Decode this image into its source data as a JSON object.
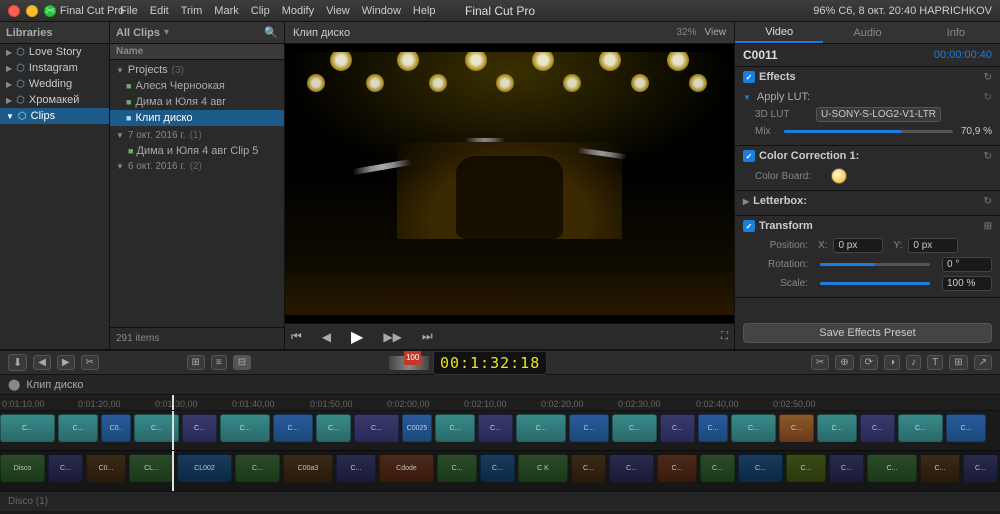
{
  "titlebar": {
    "title": "Final Cut Pro",
    "app": "Final Cut Pro",
    "menus": [
      "File",
      "Edit",
      "Trim",
      "Mark",
      "Clip",
      "Modify",
      "View",
      "Window",
      "Help"
    ],
    "right_info": "96%  С6, 8 окт.  20:40  HAPRICHKOV"
  },
  "libraries": {
    "header": "Libraries",
    "items": [
      {
        "label": "Love Story",
        "indent": 1
      },
      {
        "label": "Instagram",
        "indent": 1
      },
      {
        "label": "Wedding",
        "indent": 1
      },
      {
        "label": "Хромакей",
        "indent": 1
      },
      {
        "label": "Clips",
        "indent": 1,
        "active": true
      }
    ]
  },
  "browser": {
    "header": "All Clips",
    "count_label": "291 items",
    "col_header": "Name",
    "projects_label": "Projects",
    "projects_count": "3",
    "items": [
      {
        "label": "Алеся Черноокая"
      },
      {
        "label": "Дима и Юля 4 авг",
        "selected": true
      },
      {
        "label": "Клип диско"
      }
    ],
    "date_groups": [
      {
        "label": "7 окт. 2016 г.",
        "count": "1",
        "items": [
          "Дима и Юля 4 авг Clip 5"
        ]
      },
      {
        "label": "6 окт. 2016 г.",
        "count": "2",
        "items": []
      }
    ]
  },
  "preview": {
    "title": "Клип диско",
    "zoom": "32%",
    "view_label": "View",
    "timecode": "00:01:32:18",
    "fullscreen_btn": "⛶"
  },
  "inspector": {
    "tabs": [
      "Video",
      "Audio",
      "Info"
    ],
    "active_tab": "Video",
    "clip_name": "C0011",
    "clip_time": "00:00:00:40",
    "sections": {
      "effects": {
        "header": "Effects",
        "apply_lut": {
          "label": "Apply LUT:",
          "lut_type": "3D LUT",
          "lut_value": "U-SONY-S-LOG2-V1-LTR",
          "mix_label": "Mix",
          "mix_value": "70,9 %"
        }
      },
      "color_correction": {
        "header": "Color Correction 1:",
        "color_board_label": "Color Board:"
      },
      "letterbox": {
        "header": "Letterbox:"
      },
      "transform": {
        "header": "Transform",
        "position_label": "Position:",
        "x_label": "X:",
        "x_value": "0 px",
        "y_label": "Y:",
        "y_value": "0 px",
        "rotation_label": "Rotation:",
        "rotation_value": "0 °",
        "scale_label": "Scale:",
        "scale_value": "100 %"
      }
    },
    "save_btn": "Save Effects Preset"
  },
  "timeline": {
    "title": "Клип диско",
    "timecode": "00:1:32:18",
    "ruler_marks": [
      "0:01:10,00",
      "0:01:20,00",
      "0:01:30,00",
      "0:01:40,00",
      "0:01:50,00",
      "0:02:00,00",
      "0:02:10,00",
      "0:02:20,00",
      "0:02:30,00",
      "0:02:40,00",
      "0:02:50,00"
    ],
    "bottom_label": "Disco (1)"
  }
}
